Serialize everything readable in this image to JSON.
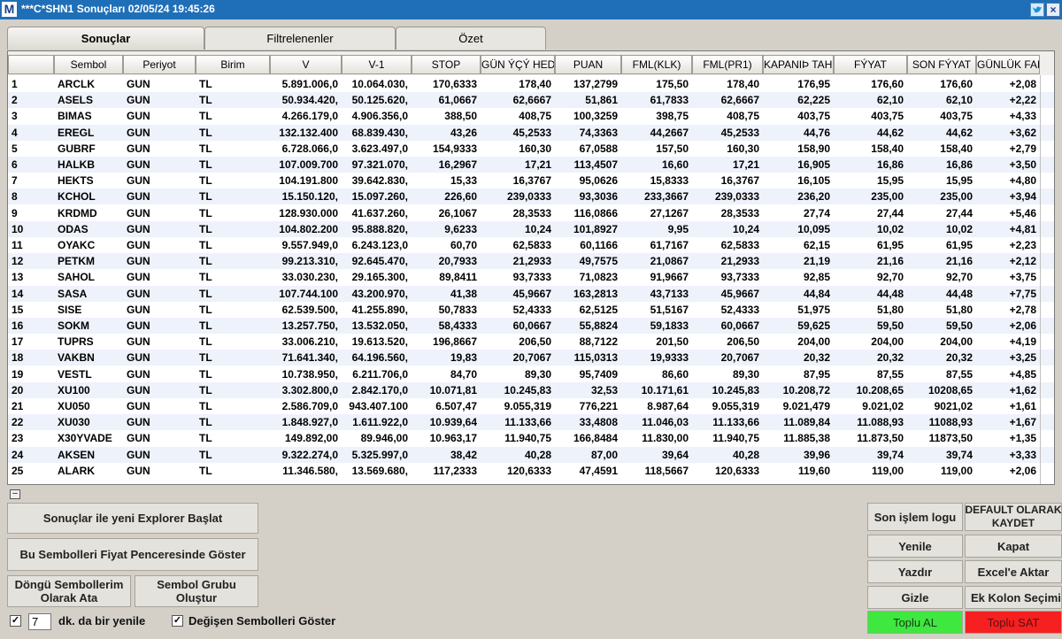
{
  "window": {
    "title": "***C*SHN1 Sonuçları  02/05/24 19:45:26",
    "app_icon": "M"
  },
  "tabs": [
    "Sonuçlar",
    "Filtrelenenler",
    "Özet"
  ],
  "columns": [
    "",
    "Sembol",
    "Periyot",
    "Birim",
    "V",
    "V-1",
    "STOP",
    "GÜN ÝÇÝ HEDEF",
    "PUAN",
    "FML(KLK)",
    "FML(PR1)",
    "KAPANIÞ TAHMİN",
    "FÝYAT",
    "SON FÝYAT",
    "GÜNLÜK FARK"
  ],
  "rows": [
    [
      "1",
      "ARCLK",
      "GUN",
      "TL",
      "5.891.006,0",
      "10.064.030,",
      "170,6333",
      "178,40",
      "137,2799",
      "175,50",
      "178,40",
      "176,95",
      "176,60",
      "176,60",
      "+2,08"
    ],
    [
      "2",
      "ASELS",
      "GUN",
      "TL",
      "50.934.420,",
      "50.125.620,",
      "61,0667",
      "62,6667",
      "51,861",
      "61,7833",
      "62,6667",
      "62,225",
      "62,10",
      "62,10",
      "+2,22"
    ],
    [
      "3",
      "BIMAS",
      "GUN",
      "TL",
      "4.266.179,0",
      "4.906.356,0",
      "388,50",
      "408,75",
      "100,3259",
      "398,75",
      "408,75",
      "403,75",
      "403,75",
      "403,75",
      "+4,33"
    ],
    [
      "4",
      "EREGL",
      "GUN",
      "TL",
      "132.132.400",
      "68.839.430,",
      "43,26",
      "45,2533",
      "74,3363",
      "44,2667",
      "45,2533",
      "44,76",
      "44,62",
      "44,62",
      "+3,62"
    ],
    [
      "5",
      "GUBRF",
      "GUN",
      "TL",
      "6.728.066,0",
      "3.623.497,0",
      "154,9333",
      "160,30",
      "67,0588",
      "157,50",
      "160,30",
      "158,90",
      "158,40",
      "158,40",
      "+2,79"
    ],
    [
      "6",
      "HALKB",
      "GUN",
      "TL",
      "107.009.700",
      "97.321.070,",
      "16,2967",
      "17,21",
      "113,4507",
      "16,60",
      "17,21",
      "16,905",
      "16,86",
      "16,86",
      "+3,50"
    ],
    [
      "7",
      "HEKTS",
      "GUN",
      "TL",
      "104.191.800",
      "39.642.830,",
      "15,33",
      "16,3767",
      "95,0626",
      "15,8333",
      "16,3767",
      "16,105",
      "15,95",
      "15,95",
      "+4,80"
    ],
    [
      "8",
      "KCHOL",
      "GUN",
      "TL",
      "15.150.120,",
      "15.097.260,",
      "226,60",
      "239,0333",
      "93,3036",
      "233,3667",
      "239,0333",
      "236,20",
      "235,00",
      "235,00",
      "+3,94"
    ],
    [
      "9",
      "KRDMD",
      "GUN",
      "TL",
      "128.930.000",
      "41.637.260,",
      "26,1067",
      "28,3533",
      "116,0866",
      "27,1267",
      "28,3533",
      "27,74",
      "27,44",
      "27,44",
      "+5,46"
    ],
    [
      "10",
      "ODAS",
      "GUN",
      "TL",
      "104.802.200",
      "95.888.820,",
      "9,6233",
      "10,24",
      "101,8927",
      "9,95",
      "10,24",
      "10,095",
      "10,02",
      "10,02",
      "+4,81"
    ],
    [
      "11",
      "OYAKC",
      "GUN",
      "TL",
      "9.557.949,0",
      "6.243.123,0",
      "60,70",
      "62,5833",
      "60,1166",
      "61,7167",
      "62,5833",
      "62,15",
      "61,95",
      "61,95",
      "+2,23"
    ],
    [
      "12",
      "PETKM",
      "GUN",
      "TL",
      "99.213.310,",
      "92.645.470,",
      "20,7933",
      "21,2933",
      "49,7575",
      "21,0867",
      "21,2933",
      "21,19",
      "21,16",
      "21,16",
      "+2,12"
    ],
    [
      "13",
      "SAHOL",
      "GUN",
      "TL",
      "33.030.230,",
      "29.165.300,",
      "89,8411",
      "93,7333",
      "71,0823",
      "91,9667",
      "93,7333",
      "92,85",
      "92,70",
      "92,70",
      "+3,75"
    ],
    [
      "14",
      "SASA",
      "GUN",
      "TL",
      "107.744.100",
      "43.200.970,",
      "41,38",
      "45,9667",
      "163,2813",
      "43,7133",
      "45,9667",
      "44,84",
      "44,48",
      "44,48",
      "+7,75"
    ],
    [
      "15",
      "SISE",
      "GUN",
      "TL",
      "62.539.500,",
      "41.255.890,",
      "50,7833",
      "52,4333",
      "62,5125",
      "51,5167",
      "52,4333",
      "51,975",
      "51,80",
      "51,80",
      "+2,78"
    ],
    [
      "16",
      "SOKM",
      "GUN",
      "TL",
      "13.257.750,",
      "13.532.050,",
      "58,4333",
      "60,0667",
      "55,8824",
      "59,1833",
      "60,0667",
      "59,625",
      "59,50",
      "59,50",
      "+2,06"
    ],
    [
      "17",
      "TUPRS",
      "GUN",
      "TL",
      "33.006.210,",
      "19.613.520,",
      "196,8667",
      "206,50",
      "88,7122",
      "201,50",
      "206,50",
      "204,00",
      "204,00",
      "204,00",
      "+4,19"
    ],
    [
      "18",
      "VAKBN",
      "GUN",
      "TL",
      "71.641.340,",
      "64.196.560,",
      "19,83",
      "20,7067",
      "115,0313",
      "19,9333",
      "20,7067",
      "20,32",
      "20,32",
      "20,32",
      "+3,25"
    ],
    [
      "19",
      "VESTL",
      "GUN",
      "TL",
      "10.738.950,",
      "6.211.706,0",
      "84,70",
      "89,30",
      "95,7409",
      "86,60",
      "89,30",
      "87,95",
      "87,55",
      "87,55",
      "+4,85"
    ],
    [
      "20",
      "XU100",
      "GUN",
      "TL",
      "3.302.800,0",
      "2.842.170,0",
      "10.071,81",
      "10.245,83",
      "32,53",
      "10.171,61",
      "10.245,83",
      "10.208,72",
      "10.208,65",
      "10208,65",
      "+1,62"
    ],
    [
      "21",
      "XU050",
      "GUN",
      "TL",
      "2.586.709,0",
      "943.407.100",
      "6.507,47",
      "9.055,319",
      "776,221",
      "8.987,64",
      "9.055,319",
      "9.021,479",
      "9.021,02",
      "9021,02",
      "+1,61"
    ],
    [
      "22",
      "XU030",
      "GUN",
      "TL",
      "1.848.927,0",
      "1.611.922,0",
      "10.939,64",
      "11.133,66",
      "33,4808",
      "11.046,03",
      "11.133,66",
      "11.089,84",
      "11.088,93",
      "11088,93",
      "+1,67"
    ],
    [
      "23",
      "X30YVADE",
      "GUN",
      "TL",
      "149.892,00",
      "89.946,00",
      "10.963,17",
      "11.940,75",
      "166,8484",
      "11.830,00",
      "11.940,75",
      "11.885,38",
      "11.873,50",
      "11873,50",
      "+1,35"
    ],
    [
      "24",
      "AKSEN",
      "GUN",
      "TL",
      "9.322.274,0",
      "5.325.997,0",
      "38,42",
      "40,28",
      "87,00",
      "39,64",
      "40,28",
      "39,96",
      "39,74",
      "39,74",
      "+3,33"
    ],
    [
      "25",
      "ALARK",
      "GUN",
      "TL",
      "11.346.580,",
      "13.569.680,",
      "117,2333",
      "120,6333",
      "47,4591",
      "118,5667",
      "120,6333",
      "119,60",
      "119,00",
      "119,00",
      "+2,06"
    ]
  ],
  "left_buttons": {
    "explorer": "Sonuçlar ile yeni Explorer Başlat",
    "price_window": "Bu Sembolleri Fiyat Penceresinde Göster",
    "cycle_line1": "Döngü Sembollerim",
    "cycle_line2": "Olarak Ata",
    "group_line1": "Sembol Grubu",
    "group_line2": "Oluştur"
  },
  "refresh": {
    "checked": true,
    "minutes": "7",
    "label": "dk. da bir yenile"
  },
  "show_changed": {
    "checked": true,
    "label": "Değişen Sembolleri Göster"
  },
  "right_buttons": {
    "last_log": "Son işlem logu",
    "default_line1": "DEFAULT OLARAK",
    "default_line2": "KAYDET",
    "refresh": "Yenile",
    "close": "Kapat",
    "print": "Yazdır",
    "excel": "Excel'e Aktar",
    "hide": "Gizle",
    "add_column": "Ek Kolon Seçimi",
    "buy_all": "Toplu AL",
    "sell_all": "Toplu SAT"
  },
  "colors": {
    "titlebar": "#1f6fb8",
    "buy": "#3fe83f",
    "sell": "#f5201f",
    "row_alt": "#eef2fb"
  }
}
